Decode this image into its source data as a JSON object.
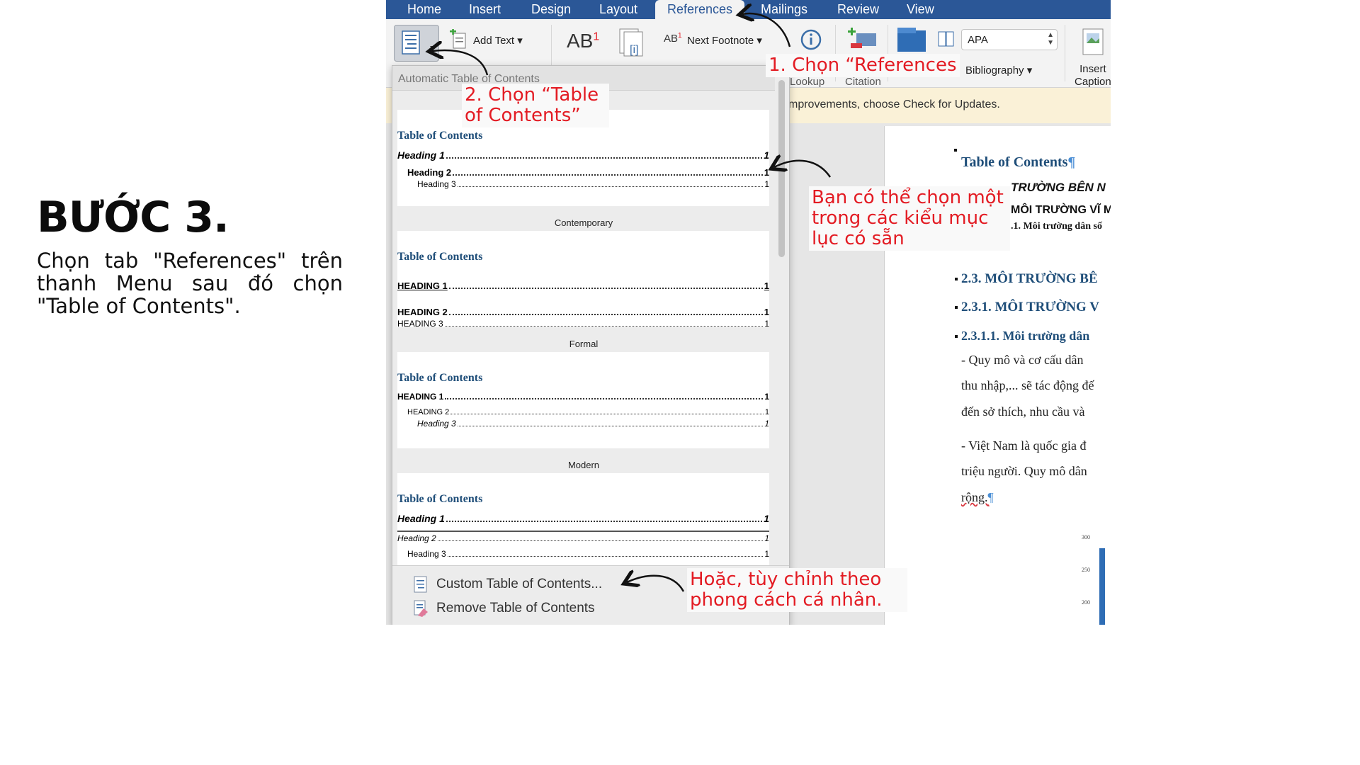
{
  "intro": {
    "step": "BƯỚC 3.",
    "description": "Chọn tab \"References\" trên thanh Menu sau đó chọn \"Table of Contents\"."
  },
  "ribbon": {
    "tabs": [
      "Home",
      "Insert",
      "Design",
      "Layout",
      "References",
      "Mailings",
      "Review",
      "View"
    ],
    "active_tab": "References",
    "add_text": "Add Text",
    "insert_footnote_glyph": "AB",
    "insert_footnote_sup": "1",
    "next_footnote": "Next Footnote",
    "citation_style": "APA",
    "bibliography": "Bibliography",
    "insert_caption": [
      "Insert",
      "Caption"
    ],
    "partial_labels": [
      "Lookup",
      "Citation"
    ]
  },
  "infobar": {
    "text": "mprovements, choose Check for Updates."
  },
  "gallery": {
    "header": "Automatic Table of Contents",
    "styles": [
      {
        "name": "",
        "title": "Table of Contents",
        "entries": [
          {
            "label": "Heading 1",
            "page": "1"
          },
          {
            "label": "Heading 2",
            "page": "1"
          },
          {
            "label": "Heading 3",
            "page": "1"
          }
        ]
      },
      {
        "name": "Contemporary",
        "title": "Table of Contents",
        "entries": [
          {
            "label": "HEADING 1",
            "page": "1"
          },
          {
            "label": "HEADING 2",
            "page": "1"
          },
          {
            "label": "HEADING 3",
            "page": "1"
          }
        ]
      },
      {
        "name": "Formal",
        "title": "Table of Contents",
        "entries": [
          {
            "label": "HEADING 1",
            "page": "1"
          },
          {
            "label": "HEADING 2",
            "page": "1"
          },
          {
            "label": "Heading 3",
            "page": "1"
          }
        ]
      },
      {
        "name": "Modern",
        "title": "Table of Contents",
        "entries": [
          {
            "label": "Heading 1",
            "page": "1"
          },
          {
            "label": "Heading 2",
            "page": "1"
          },
          {
            "label": "Heading 3",
            "page": "1"
          }
        ]
      }
    ],
    "custom": "Custom Table of Contents...",
    "remove": "Remove Table of Contents"
  },
  "document": {
    "toc_title": "Table of Contents",
    "lines": [
      "TRƯỜNG BÊN N",
      "MÔI TRƯỜNG VĨ M",
      ".1. Môi trường dân số",
      "2.3. MÔI TRƯỜNG BÊ",
      "2.3.1. MÔI TRƯỜNG V",
      "2.3.1.1. Môi trường dân"
    ],
    "body": [
      "- Quy mô và cơ cấu dân",
      "thu nhập,... sẽ tác động đế",
      "đến sở thích, nhu cầu và",
      "- Việt Nam là quốc gia đ",
      "triệu người. Quy mô dân",
      "rộng."
    ],
    "chart_ticks": [
      "300",
      "250",
      "200"
    ]
  },
  "callouts": {
    "c1": "1. Chọn “References",
    "c2": "2. Chọn “Table of Contents”",
    "c3": "Bạn có thể chọn một trong các kiểu mục lục có sẵn",
    "c4": "Hoặc, tùy chỉnh theo phong cách cá nhân."
  },
  "colors": {
    "tab_bar": "#2b5797",
    "callout_text": "#e31b23",
    "toc_title": "#1f4e79",
    "doc_heading": "#1f4e79"
  }
}
